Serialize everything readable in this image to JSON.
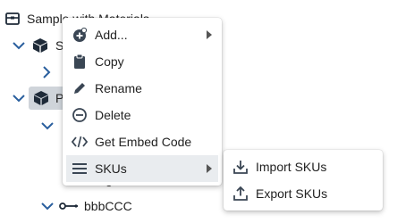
{
  "tree": {
    "root_label": "Sample with Materials",
    "row2_label": "S",
    "row4_label": "P",
    "bottom_label": "bbbCCC",
    "partial_bottom_glyph": "g"
  },
  "context_menu": {
    "items": [
      {
        "label": "Add...",
        "icon": "add-icon",
        "has_submenu": true
      },
      {
        "label": "Copy",
        "icon": "copy-icon",
        "has_submenu": false
      },
      {
        "label": "Rename",
        "icon": "pencil-icon",
        "has_submenu": false
      },
      {
        "label": "Delete",
        "icon": "minus-circle-icon",
        "has_submenu": false
      },
      {
        "label": "Get Embed Code",
        "icon": "code-icon",
        "has_submenu": false
      },
      {
        "label": "SKUs",
        "icon": "list-icon",
        "has_submenu": true,
        "active": true
      }
    ]
  },
  "sku_submenu": {
    "items": [
      {
        "label": "Import SKUs",
        "icon": "import-icon"
      },
      {
        "label": "Export SKUs",
        "icon": "export-icon"
      }
    ]
  },
  "colors": {
    "icon_dark": "#1e2a38",
    "chevron_blue": "#2a5f9e",
    "selected_row": "#cfd4da",
    "active_item": "#e9ecef"
  }
}
